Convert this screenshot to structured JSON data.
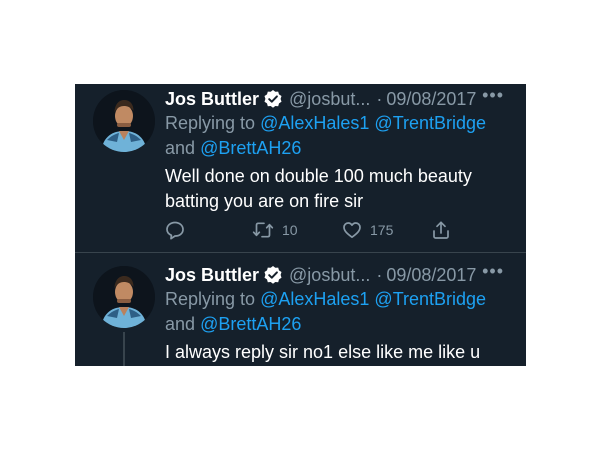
{
  "tweets": [
    {
      "author_name": "Jos Buttler",
      "handle": "@josbut...",
      "separator": "·",
      "date": "09/08/2017",
      "more_label": "•••",
      "replying_prefix": "Replying to",
      "mention_1": "@AlexHales1",
      "mention_2": "@TrentBridge",
      "and_word": "and",
      "mention_3": "@BrettAH26",
      "text": "Well done on double 100 much beauty batting you are on fire sir",
      "retweet_count": "10",
      "like_count": "175"
    },
    {
      "author_name": "Jos Buttler",
      "handle": "@josbut...",
      "separator": "·",
      "date": "09/08/2017",
      "more_label": "•••",
      "replying_prefix": "Replying to",
      "mention_1": "@AlexHales1",
      "mention_2": "@TrentBridge",
      "and_word": "and",
      "mention_3": "@BrettAH26",
      "text": "I always reply sir no1 else like me like u"
    }
  ],
  "icons": {
    "verified": "verified-badge-icon",
    "reply": "reply-icon",
    "retweet": "retweet-icon",
    "like": "heart-icon",
    "share": "share-icon",
    "more": "more-icon"
  },
  "colors": {
    "background": "#15202b",
    "accent": "#1da1f2",
    "muted": "#8899a6",
    "text": "#ffffff",
    "divider": "#38444d"
  }
}
